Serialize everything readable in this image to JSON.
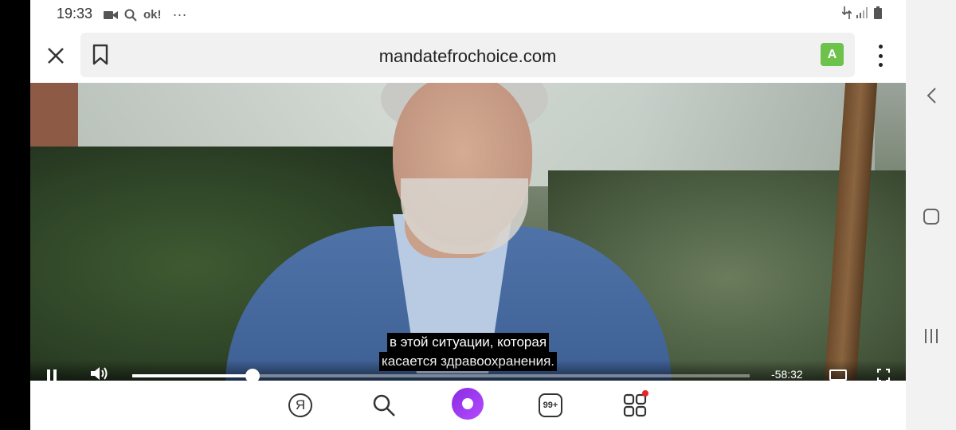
{
  "status_bar": {
    "time": "19:33",
    "left_icons": [
      "video-call-icon",
      "search-icon",
      "ok-icon",
      "more-dots-icon"
    ],
    "ok_text": "ok!",
    "more_text": "···",
    "right_icons": [
      "data-transfer-icon",
      "signal-icon",
      "battery-icon"
    ]
  },
  "browser": {
    "url": "mandatefrochoice.com",
    "translate_label": "A"
  },
  "video": {
    "subtitle_line1": "в этой ситуации, которая",
    "subtitle_line2": "касается здравоохранения.",
    "time_remaining": "-58:32",
    "progress": 0.195
  },
  "bottom_bar": {
    "yandex_label": "Я",
    "tabs_count": "99+"
  },
  "colors": {
    "translate_green": "#6cc24a",
    "alice_purple": "#8a2be2",
    "notification_red": "#e8242a"
  }
}
